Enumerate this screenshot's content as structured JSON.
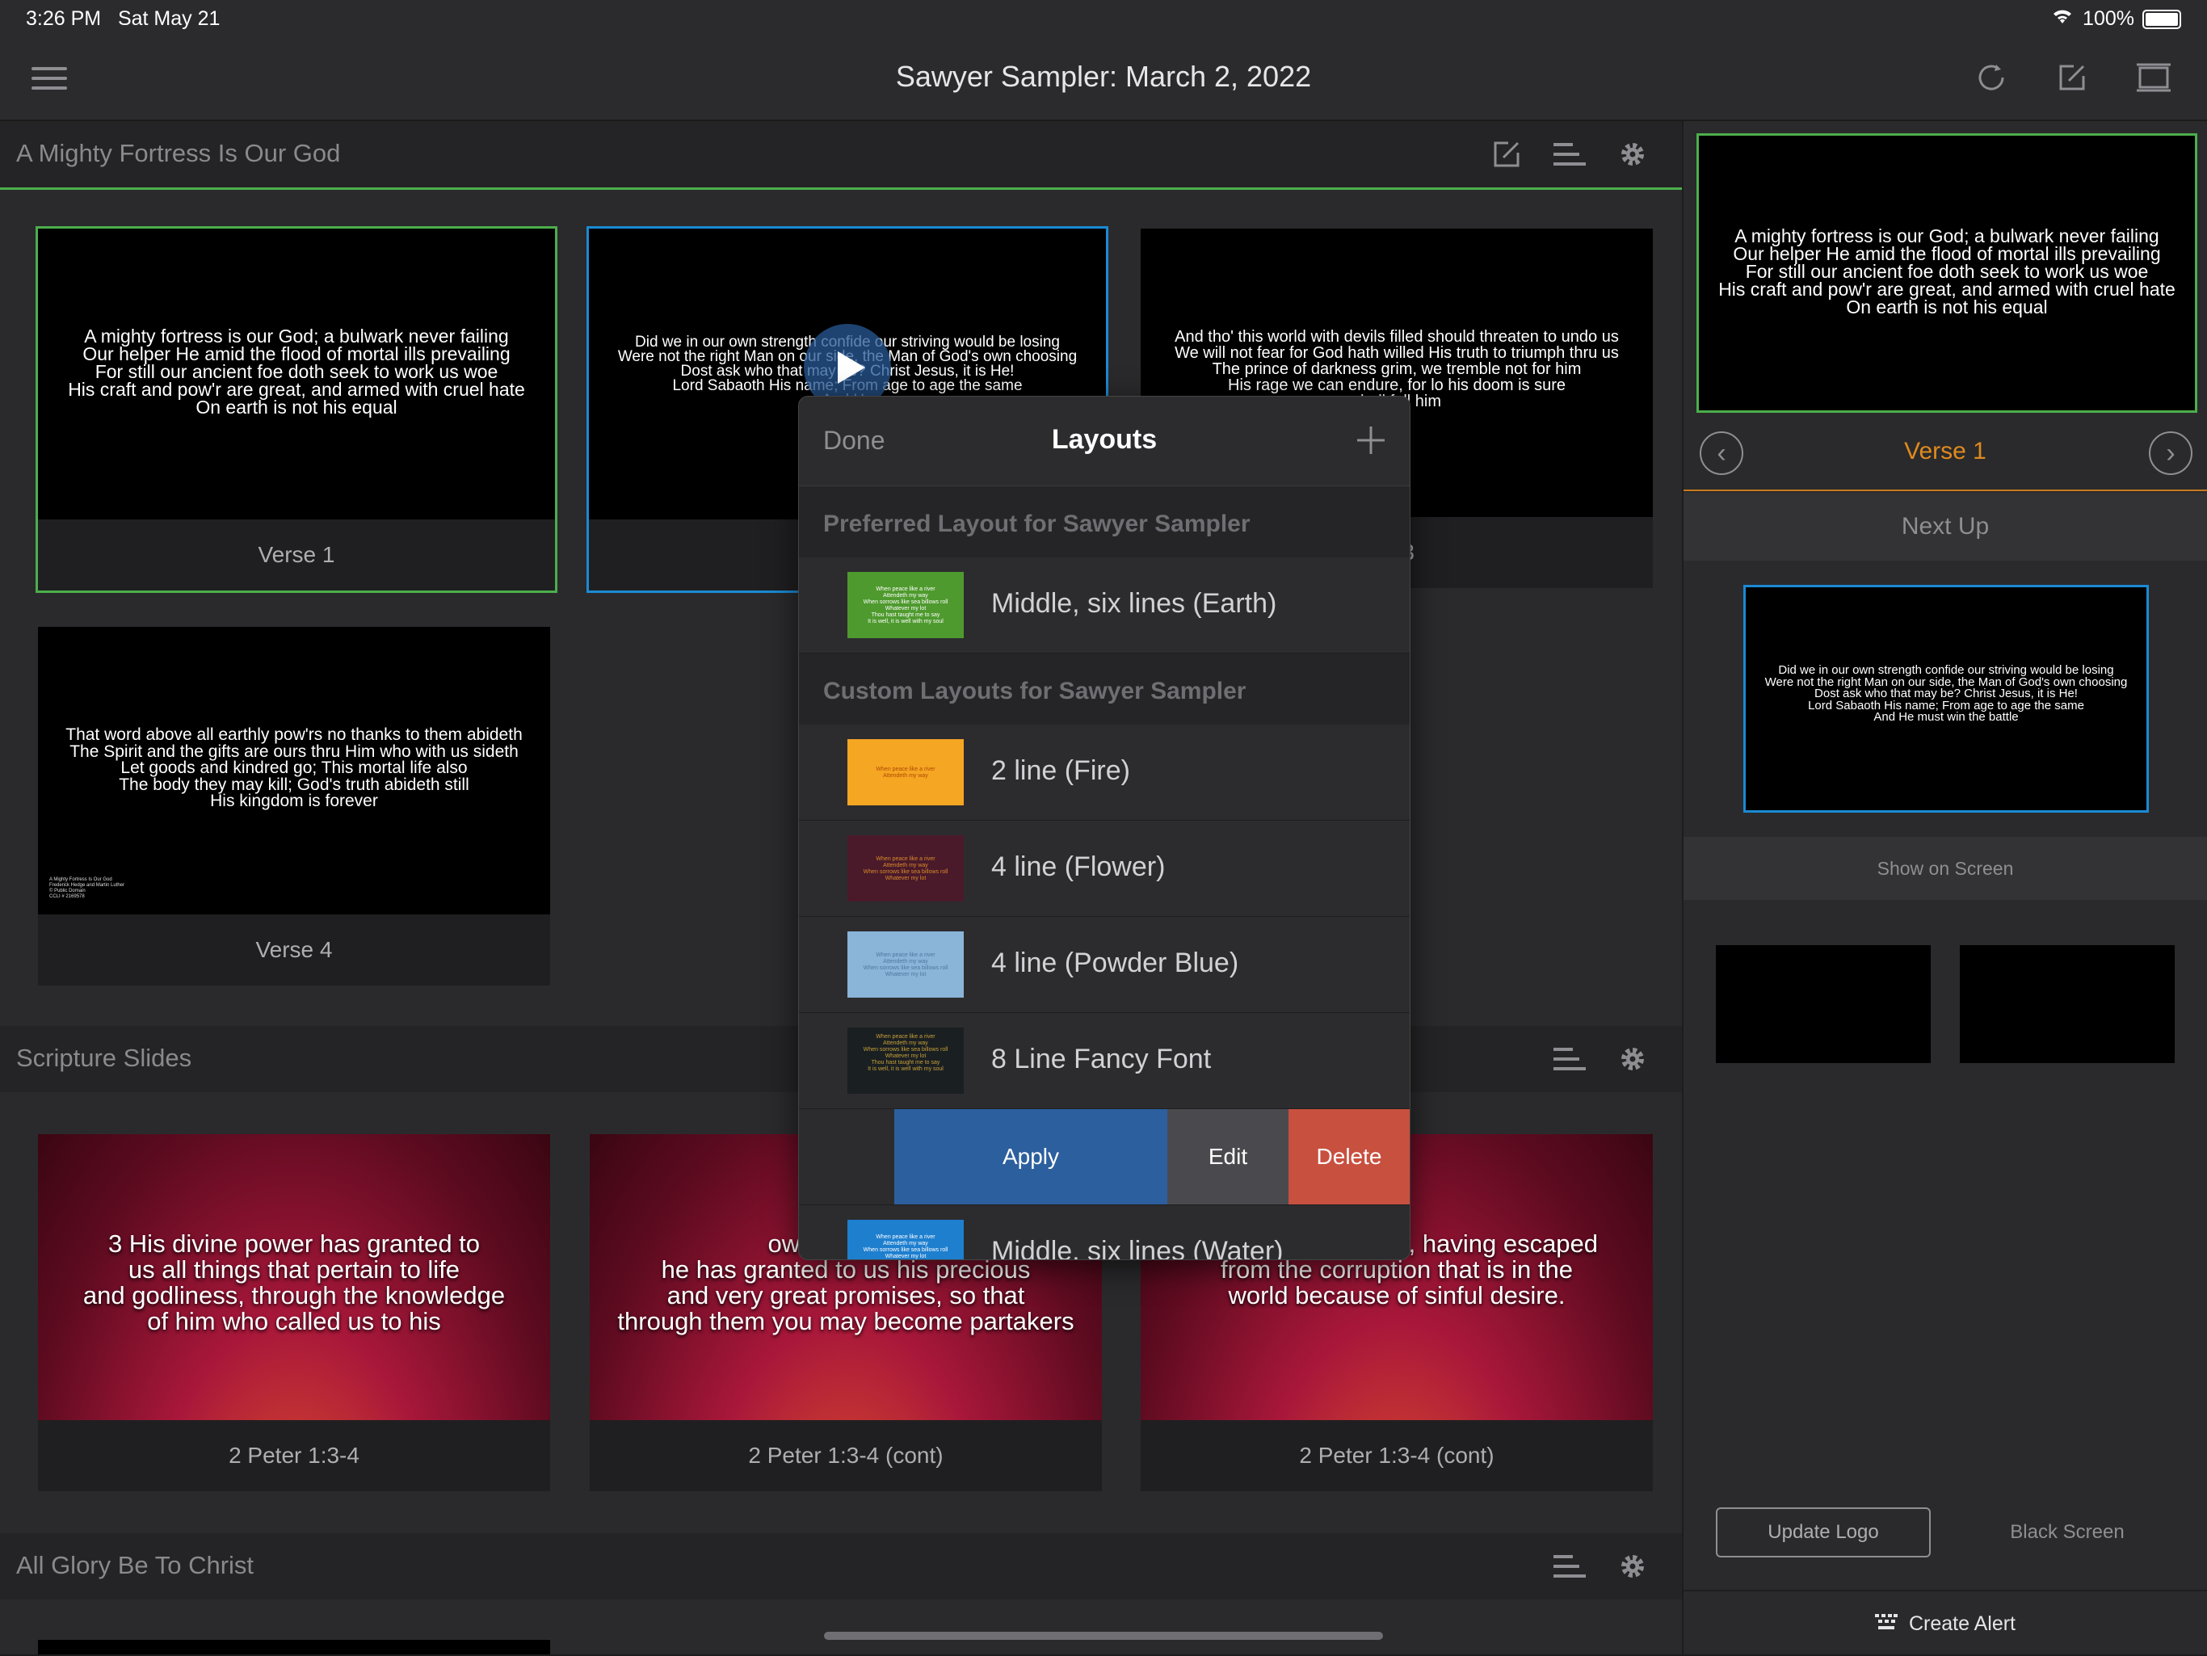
{
  "status_bar": {
    "time": "3:26 PM",
    "date": "Sat May 21",
    "battery": "100%"
  },
  "nav": {
    "title": "Sawyer Sampler: March 2, 2022"
  },
  "sections": {
    "mighty": {
      "title": "A Mighty Fortress Is Our God"
    },
    "scripture": {
      "title": "Scripture Slides"
    },
    "glory": {
      "title": "All Glory Be To Christ"
    }
  },
  "slides": {
    "verse1": {
      "label": "Verse 1",
      "text": "A mighty fortress is our God; a bulwark never failing\nOur helper He amid the flood of mortal ills prevailing\nFor still our ancient foe doth seek to work us woe\nHis craft and pow'r are great, and armed with cruel hate\nOn earth is not his equal"
    },
    "verse2": {
      "text": "Did we in our own strength confide our striving would be losing\nWere not the right Man on our side, the Man of God's own choosing\nDost ask who that may be? Christ Jesus, it is He!\nLord Sabaoth His name; From age to age the same\nAnd He"
    },
    "verse3": {
      "label_tail": "e 3",
      "text": "And tho' this world with devils filled should threaten to undo us\nWe will not fear for God hath willed His truth to triumph thru us\nThe prince of darkness grim, we tremble not for him\nHis rage we can endure, for lo his doom is sure\nshall fell him"
    },
    "verse4": {
      "label": "Verse 4",
      "text": "That word above all earthly pow'rs no thanks to them abideth\nThe Spirit and the gifts are ours thru Him who with us sideth\nLet goods and kindred go; This mortal life also\nThe body they may kill; God's truth abideth still\nHis kingdom is forever",
      "credits": "A Mighty Fortress Is Our God\nFrederick Hedge and Martin Luther\n© Public Domain\nCCLI # 2169578"
    },
    "peter1": {
      "label": "2 Peter 1:3-4",
      "text": "3 His divine power has granted to\nus all things that pertain to life\nand godliness, through the knowledge\nof him who called us to his"
    },
    "peter2": {
      "label": "2 Peter 1:3-4 (cont)",
      "text": "own glory and\nhe has granted to us his precious\nand very great promises, so that\nthrough them you may become partakers"
    },
    "peter3": {
      "label": "2 Peter 1:3-4 (cont)",
      "text": "of the divine nature, having escaped\nfrom the corruption that is in the\nworld because of sinful desire."
    }
  },
  "right_panel": {
    "current_text": "A mighty fortress is our God; a bulwark never failing\nOur helper He amid the flood of mortal ills prevailing\nFor still our ancient foe doth seek to work us woe\nHis craft and pow'r are great, and armed with cruel hate\nOn earth is not his equal",
    "current_label": "Verse 1",
    "next_up": "Next Up",
    "next_text": "Did we in our own strength confide our striving would be losing\nWere not the right Man on our side, the Man of God's own choosing\nDost ask who that may be? Christ Jesus, it is He!\nLord Sabaoth His name; From age to age the same\nAnd He must win the battle",
    "show_on_screen": "Show on Screen",
    "update_logo": "Update Logo",
    "black_screen": "Black Screen",
    "create_alert": "Create Alert"
  },
  "popover": {
    "done": "Done",
    "title": "Layouts",
    "preferred_header": "Preferred Layout for Sawyer Sampler",
    "custom_header": "Custom Layouts for Sawyer Sampler",
    "preferred": {
      "name": "Middle, six lines (Earth)",
      "color": "#4e9a2e"
    },
    "layouts": [
      {
        "name": "2 line (Fire)",
        "color": "#f5a623"
      },
      {
        "name": "4 line (Flower)",
        "color": "#4a1a2a"
      },
      {
        "name": "4 line (Powder Blue)",
        "color": "#8ab4d8"
      },
      {
        "name": "8 Line Fancy Font",
        "color": "#1a1f22"
      },
      {
        "name": "Middle, six lines (Water)",
        "color": "#1e7fcf"
      }
    ],
    "actions": {
      "apply": "Apply",
      "edit": "Edit",
      "delete": "Delete"
    },
    "mini_text": "When peace like a river\nAttendeth my way\nWhen sorrows like sea billows roll\nWhatever my lot\nThou hast taught me to say\nIt is well, it is well with my soul"
  }
}
